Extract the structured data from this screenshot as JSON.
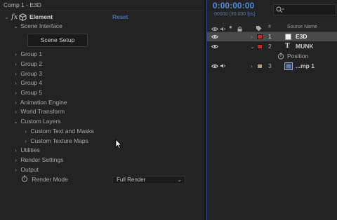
{
  "effect_controls": {
    "comp_label": "Comp 1 - E3D",
    "effect": {
      "fx_label": "fx",
      "name": "Element",
      "reset_label": "Reset"
    },
    "tree": [
      {
        "label": "Scene Interface",
        "expanded": true
      },
      {
        "label": "Group 1",
        "expanded": false
      },
      {
        "label": "Group 2",
        "expanded": false
      },
      {
        "label": "Group 3",
        "expanded": false
      },
      {
        "label": "Group 4",
        "expanded": false
      },
      {
        "label": "Group 5",
        "expanded": false
      },
      {
        "label": "Animation Engine",
        "expanded": false
      },
      {
        "label": "World Transform",
        "expanded": false
      },
      {
        "label": "Custom Layers",
        "expanded": true
      },
      {
        "label": "Custom Text and Masks",
        "expanded": false
      },
      {
        "label": "Custom Texture Maps",
        "expanded": false
      },
      {
        "label": "Utilities",
        "expanded": false
      },
      {
        "label": "Render Settings",
        "expanded": false
      },
      {
        "label": "Output",
        "expanded": false
      }
    ],
    "scene_setup_label": "Scene Setup",
    "render_mode": {
      "label": "Render Mode",
      "value": "Full Render"
    }
  },
  "timeline": {
    "timecode": "0:00:00:00",
    "frame_info": "00000 (30.000 fps)",
    "search_placeholder": "",
    "columns": {
      "number": "#",
      "source_name": "Source Name"
    },
    "layers": [
      {
        "number": "1",
        "name": "E3D",
        "label_color": "#c8282a",
        "selected": true,
        "type": "solid"
      },
      {
        "number": "2",
        "name": "MUNK",
        "label_color": "#c8282a",
        "selected": false,
        "type": "text",
        "expanded": true
      },
      {
        "number": "3",
        "name": "...mp 1",
        "label_color": "#b19f85",
        "selected": false,
        "type": "precomp"
      }
    ],
    "property": {
      "name": "Position"
    }
  },
  "colors": {
    "accent_blue": "#4f8ee3",
    "label_red": "#c8282a",
    "label_sand": "#b19f85"
  }
}
